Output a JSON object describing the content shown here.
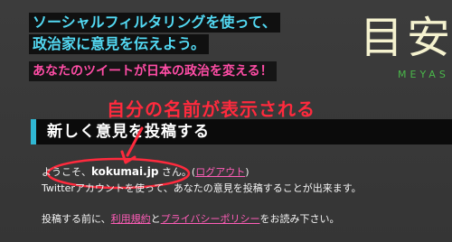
{
  "header": {
    "tagline_1": "ソーシャルフィルタリングを使って、",
    "tagline_2": "政治家に意見を伝えよう。",
    "tagline_3": "あなたのツイートが日本の政治を変える！"
  },
  "logo": {
    "text": "目安",
    "subtext": "MEYAS"
  },
  "section": {
    "title": "新しく意見を投稿する"
  },
  "annotation": {
    "text": "自分の名前が表示される"
  },
  "body": {
    "welcome_prefix": "ようこそ、",
    "username": "kokumai.jp",
    "welcome_suffix": " さん。",
    "logout_open": "(",
    "logout_label": "ログアウト",
    "logout_close": ")",
    "twitter_desc": "Twitterアカウントを使って、あなたの意見を投稿することが出来ます。",
    "notice_prefix": "投稿する前に、",
    "terms_label": "利用規約",
    "and": "と",
    "privacy_label": "プライバシーポリシー",
    "notice_suffix": "をお読み下さい。"
  },
  "colors": {
    "accent_cyan": "#53d9f3",
    "accent_pink": "#ff4da6",
    "annotation_red": "#ff2a3d",
    "logo_cream": "#f5f2cf",
    "logo_green": "#4ab84a"
  }
}
